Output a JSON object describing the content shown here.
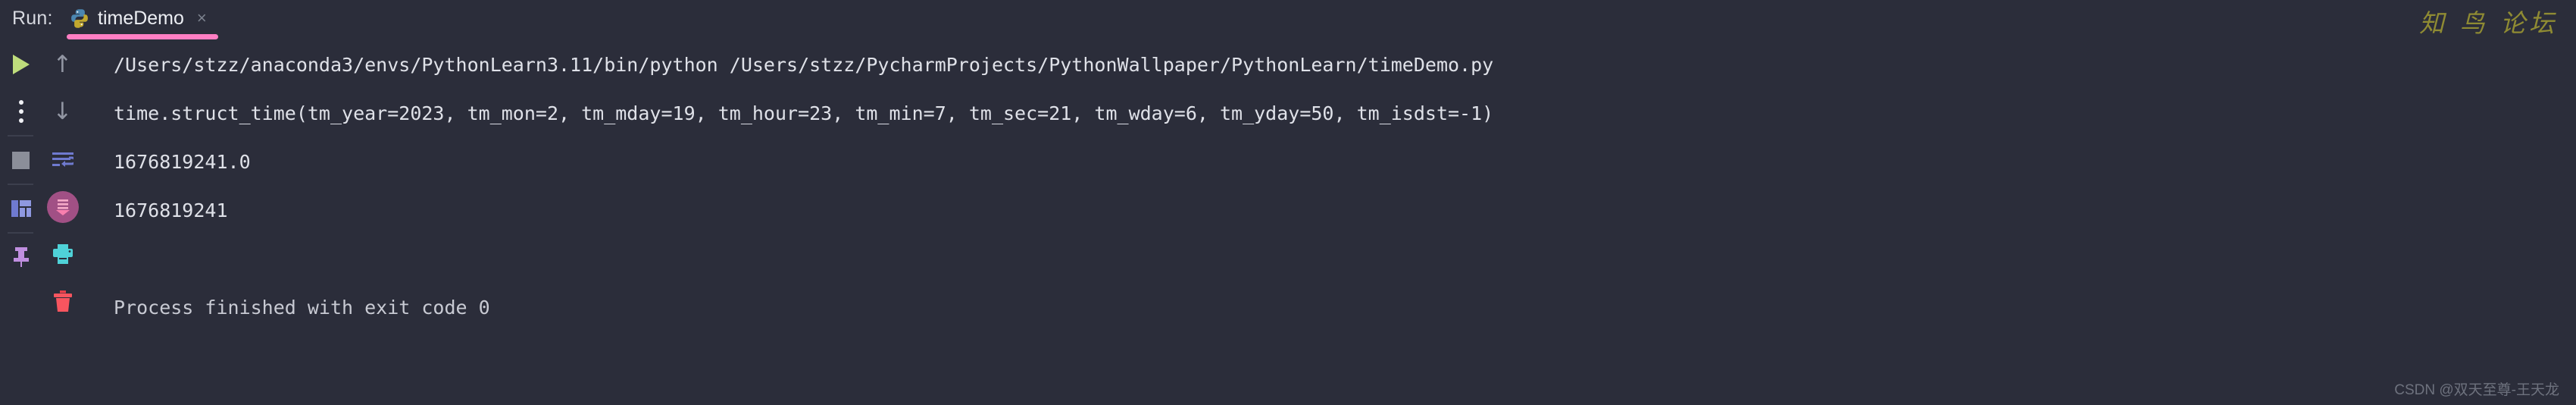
{
  "window": {
    "background_color": "#2b2d3a",
    "run_label": "Run:"
  },
  "tab": {
    "title": "timeDemo",
    "close_label": "×",
    "icon": "python-icon",
    "underline_color": "#ff7ec3"
  },
  "toolbar_left": {
    "items": [
      {
        "name": "rerun-button",
        "icon": "play-icon",
        "color": "#bfdd7c"
      },
      {
        "name": "more-options-button",
        "icon": "vertical-dots-icon",
        "color": "#f0f1f5"
      },
      {
        "name": "stop-button",
        "icon": "stop-square-icon",
        "color": "#8b8e99"
      },
      {
        "name": "layout-button",
        "icon": "layout-grid-icon",
        "color": "#7b86d6"
      },
      {
        "name": "pin-tab-button",
        "icon": "pin-icon",
        "color": "#c08fe0"
      }
    ]
  },
  "toolbar_right": {
    "items": [
      {
        "name": "up-button",
        "icon": "arrow-up-icon",
        "glyph": "↑",
        "color": "#9296a3"
      },
      {
        "name": "down-button",
        "icon": "arrow-down-icon",
        "glyph": "↓",
        "color": "#9296a3"
      },
      {
        "name": "soft-wrap-button",
        "icon": "soft-wrap-icon",
        "color": "#7b86d6"
      },
      {
        "name": "scroll-to-end-button",
        "icon": "scroll-to-end-icon",
        "color": "#a15085"
      },
      {
        "name": "print-button",
        "icon": "printer-icon",
        "color": "#4fd2d8"
      },
      {
        "name": "clear-all-button",
        "icon": "trash-icon",
        "color": "#f8555f"
      }
    ]
  },
  "console": {
    "lines": [
      "/Users/stzz/anaconda3/envs/PythonLearn3.11/bin/python /Users/stzz/PycharmProjects/PythonWallpaper/PythonLearn/timeDemo.py",
      "time.struct_time(tm_year=2023, tm_mon=2, tm_mday=19, tm_hour=23, tm_min=7, tm_sec=21, tm_wday=6, tm_yday=50, tm_isdst=-1)",
      "1676819241.0",
      "1676819241",
      "",
      "Process finished with exit code 0"
    ]
  },
  "watermarks": {
    "top_right": "知 鸟 论坛",
    "bottom_right": "CSDN @双天至尊-王天龙"
  }
}
